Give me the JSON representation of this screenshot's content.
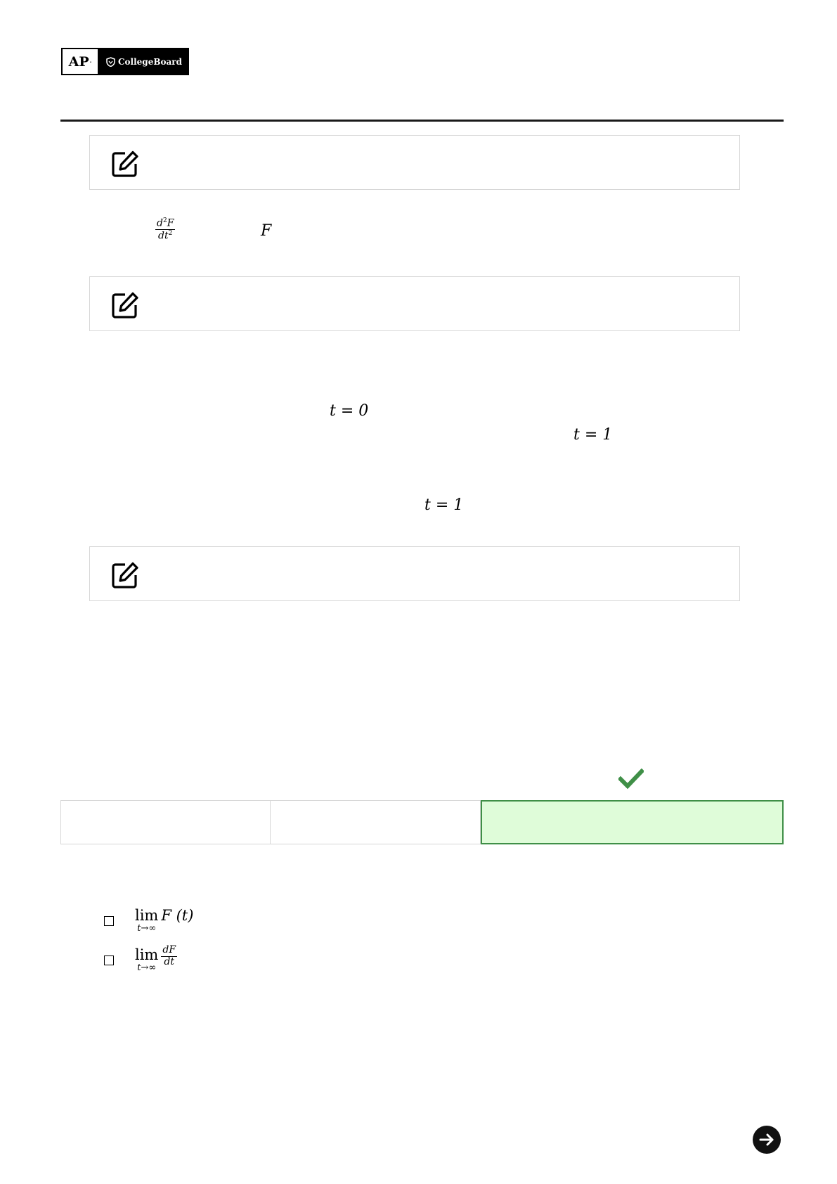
{
  "logo": {
    "ap_text": "AP",
    "ap_mark": "·",
    "brand_text": "CollegeBoard",
    "icon": "acorn-shield-icon"
  },
  "notes": [
    {
      "icon": "edit-icon"
    },
    {
      "icon": "edit-icon"
    },
    {
      "icon": "edit-icon"
    }
  ],
  "math": {
    "d2f_num": "d",
    "d2f_num_exp": "2",
    "d2f_num_var": "F",
    "d2f_den": "dt",
    "d2f_den_exp": "2",
    "f_symbol": "F",
    "t0": "t = 0",
    "t1_a": "t = 1",
    "t1_b": "t = 1"
  },
  "tabs": {
    "selected_index": 3,
    "selected_color": "#dffcd9",
    "selected_border": "#3f8f47",
    "check_icon": "check-icon",
    "check_color": "#3f8f47"
  },
  "options": [
    {
      "lim": "lim",
      "sub": "t→∞",
      "expr": "F (t)"
    },
    {
      "lim": "lim",
      "sub": "t→∞",
      "num": "dF",
      "den": "dt"
    }
  ],
  "navigation": {
    "next_icon": "arrow-right-icon"
  }
}
